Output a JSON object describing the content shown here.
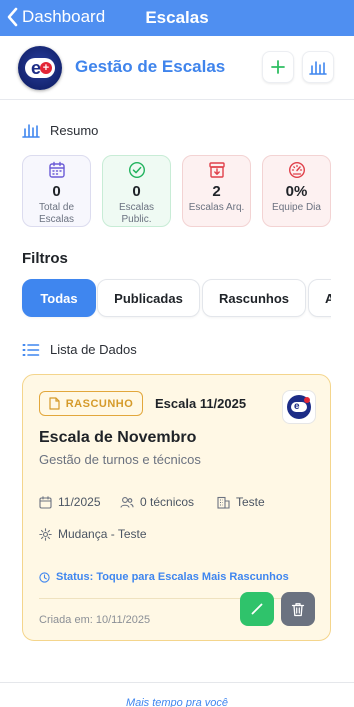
{
  "nav": {
    "back_label": "Dashboard",
    "title": "Escalas"
  },
  "header": {
    "title": "Gestão de Escalas",
    "logo_letter": "e",
    "logo_plus": "+"
  },
  "summary": {
    "label": "Resumo",
    "cards": [
      {
        "icon": "calendar-icon",
        "value": "0",
        "label": "Total de Escalas",
        "color": "#6b5bd6"
      },
      {
        "icon": "check-circle-icon",
        "value": "0",
        "label": "Escalas Public.",
        "color": "#22b35e"
      },
      {
        "icon": "archive-icon",
        "value": "2",
        "label": "Escalas Arq.",
        "color": "#e0404a"
      },
      {
        "icon": "gauge-icon",
        "value": "0%",
        "label": "Equipe Dia",
        "color": "#e0404a"
      }
    ]
  },
  "filters": {
    "title": "Filtros",
    "chips": [
      "Todas",
      "Publicadas",
      "Rascunhos",
      "Arquivadas"
    ],
    "active_index": 0
  },
  "list": {
    "label": "Lista de Dados"
  },
  "card": {
    "badge": "RASCUNHO",
    "period": "Escala 11/2025",
    "title": "Escala de Novembro",
    "subtitle": "Gestão de turnos e técnicos",
    "month": "11/2025",
    "technicians": "0 técnicos",
    "department": "Teste",
    "change": "Mudança - Teste",
    "status": "Status: Toque para Escalas Mais Rascunhos",
    "created": "Criada em: 10/11/2025"
  },
  "footer": {
    "text": "Mais tempo pra você"
  },
  "colors": {
    "primary": "#3f86ef",
    "navbar": "#4f8ff1",
    "draft_bg": "#fff8e5",
    "draft_border": "#f4d58c",
    "draft_accent": "#e2a73c",
    "edit": "#2fc36b",
    "delete": "#6b7280"
  }
}
